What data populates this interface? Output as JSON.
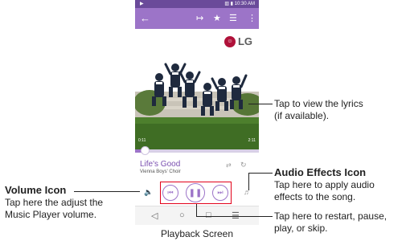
{
  "status_bar": {
    "time": "10:30 AM"
  },
  "action_bar": {
    "back_icon": "back-arrow-icon",
    "icons": [
      "share-icon",
      "star-icon",
      "playlist-icon",
      "overflow-menu-icon"
    ]
  },
  "album": {
    "logo_text": "LG",
    "time_elapsed": "0:11",
    "time_total": "2:11"
  },
  "playback": {
    "progress_fraction": 0.08,
    "song_title": "Life's Good",
    "artist": "Vienna Boys' Choir"
  },
  "controls": {
    "rewind_icon": "rewind-icon",
    "pause_icon": "pause-icon",
    "fast_forward_icon": "fast-forward-icon",
    "volume_icon": "volume-icon",
    "audio_effects_icon": "audio-effects-icon",
    "shuffle_icon": "shuffle-icon",
    "repeat_icon": "repeat-icon"
  },
  "navbar": {
    "icons": [
      "back-nav-icon",
      "home-nav-icon",
      "recent-apps-icon",
      "menu-nav-icon"
    ]
  },
  "callouts": {
    "lyrics": {
      "line1": "Tap to view the lyrics",
      "line2": "(if available)."
    },
    "audio_effects": {
      "title": "Audio Effects Icon",
      "line1": "Tap here to apply audio",
      "line2": "effects to the song."
    },
    "volume": {
      "title": "Volume Icon",
      "line1": "Tap here the adjust the",
      "line2": "Music Player volume."
    },
    "controls": {
      "line1": "Tap here to restart, pause,",
      "line2": "play, or skip."
    }
  },
  "caption": "Playback Screen",
  "colors": {
    "accent": "#9c74c8",
    "status_bar": "#6a4a9a",
    "highlight_box": "#e2001a"
  }
}
